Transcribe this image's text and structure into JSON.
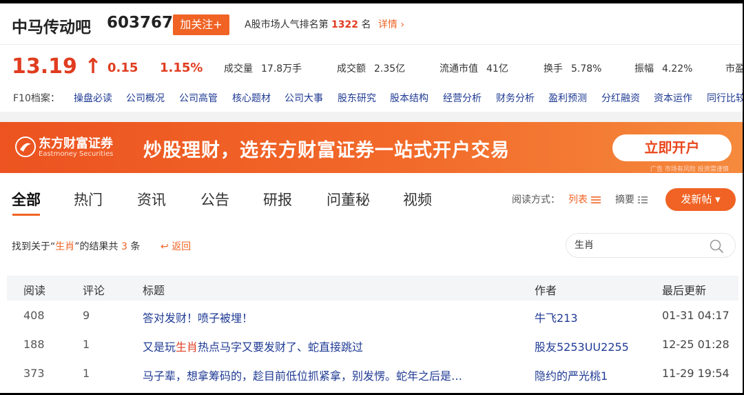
{
  "header": {
    "bar_title": "中马传动吧",
    "stock_code": "603767",
    "follow_label": "加关注+",
    "rank_prefix": "A股市场人气排名第",
    "rank_value": "1322",
    "rank_suffix": "名",
    "rank_detail": "详情"
  },
  "quote": {
    "price": "13.19",
    "arrow": "↑",
    "change": "0.15",
    "change_pct": "1.15%",
    "stats": [
      {
        "label": "成交量",
        "value": "17.8万手"
      },
      {
        "label": "成交额",
        "value": "2.35亿"
      },
      {
        "label": "流通市值",
        "value": "41亿"
      },
      {
        "label": "换手",
        "value": "5.78%"
      },
      {
        "label": "振幅",
        "value": "4.22%"
      },
      {
        "label": "市盈",
        "value": ""
      }
    ]
  },
  "f10": {
    "label": "F10档案：",
    "items": [
      "操盘必读",
      "公司概况",
      "公司高管",
      "核心题材",
      "公司大事",
      "股东研究",
      "股本结构",
      "经营分析",
      "财务分析",
      "盈利预测",
      "分红融资",
      "资本运作",
      "同行比较"
    ]
  },
  "banner": {
    "brand": "东方财富证券",
    "brand_en": "Eastmoney Securities",
    "slogan": "炒股理财，选东方财富证券一站式开户交易",
    "cta": "立即开户",
    "note": "广告 市场有风险 投资需谨慎"
  },
  "tabs": {
    "items": [
      "全部",
      "热门",
      "资讯",
      "公告",
      "研报",
      "问董秘",
      "视频"
    ],
    "active": "全部",
    "read_mode_label": "阅读方式：",
    "mode_list": "列表",
    "mode_abstract": "摘要",
    "post_label": "发新帖"
  },
  "search": {
    "result_prefix": "找到关于“",
    "keyword": "生肖",
    "result_mid": "”的结果共",
    "count": "3",
    "result_suffix": "条",
    "back_label": "返回",
    "query": "生肖"
  },
  "table": {
    "columns": [
      "阅读",
      "评论",
      "标题",
      "作者",
      "最后更新"
    ],
    "rows": [
      {
        "read": "408",
        "comments": "9",
        "title_pre": "答对发财！喷子被埋！",
        "title_hl": "",
        "title_post": "",
        "author": "牛飞213",
        "updated": "01-31 04:17"
      },
      {
        "read": "188",
        "comments": "1",
        "title_pre": "又是玩",
        "title_hl": "生肖",
        "title_post": "热点马字又要发财了、蛇直接跳过",
        "author": "股友5253UU2255",
        "updated": "12-25 01:28"
      },
      {
        "read": "373",
        "comments": "1",
        "title_pre": "马子辈，想拿筹码的，趁目前低位抓紧拿，别发愣。蛇年之后是…",
        "title_hl": "",
        "title_post": "",
        "author": "隐约的严光桃1",
        "updated": "11-29 19:54"
      }
    ]
  }
}
